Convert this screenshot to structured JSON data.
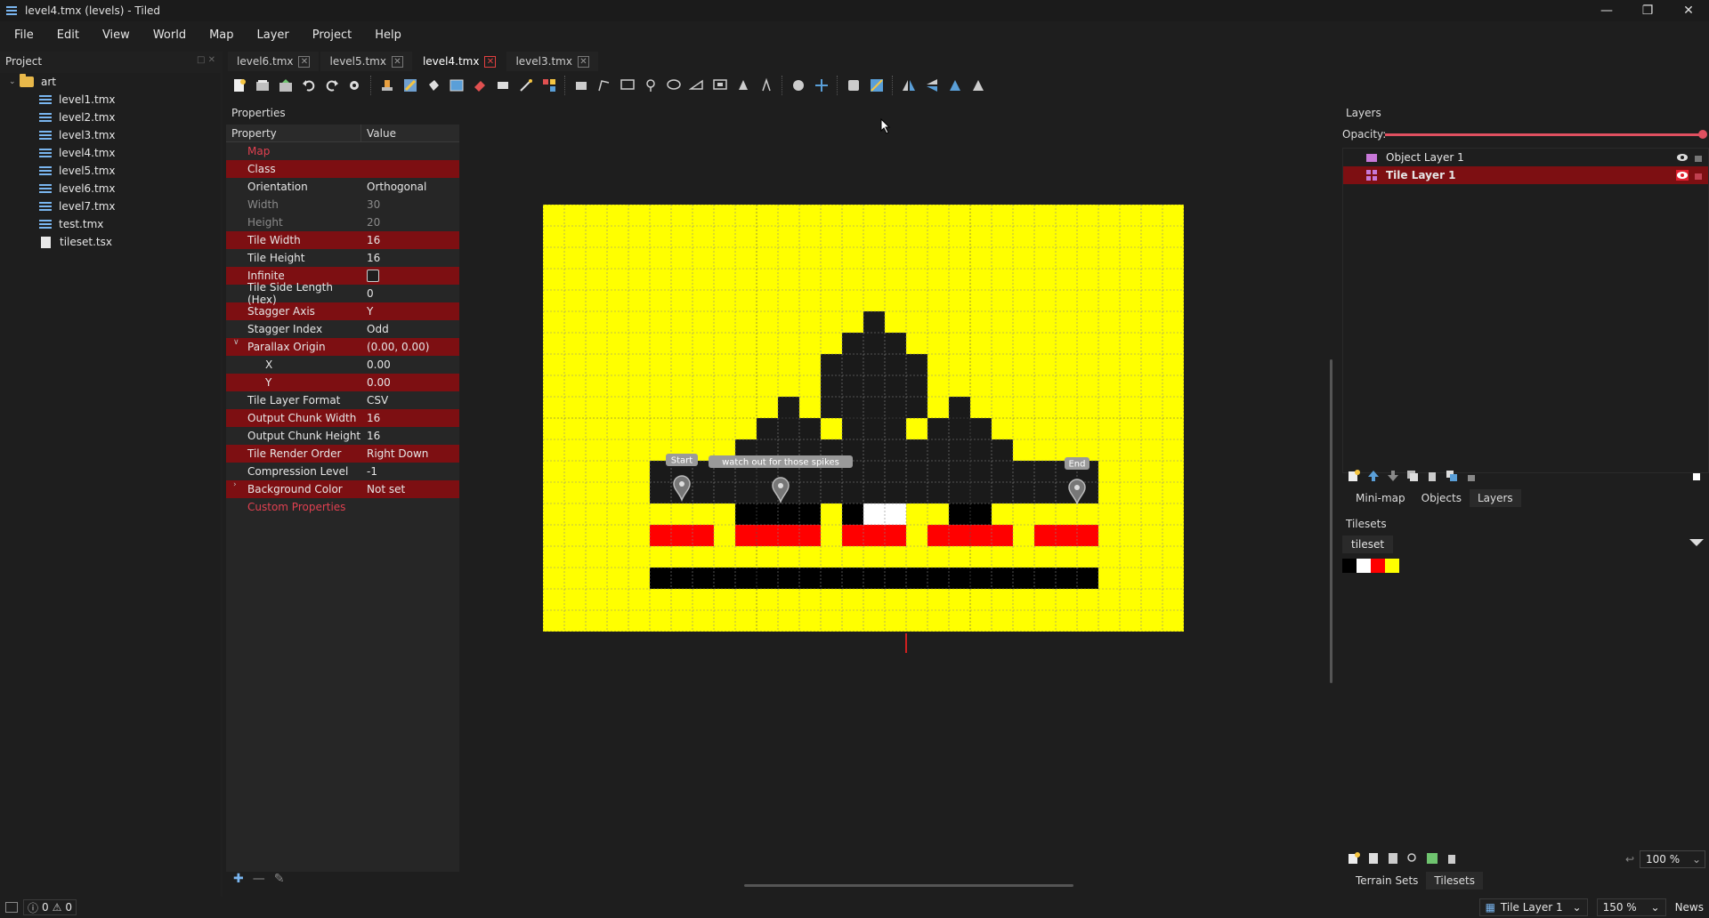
{
  "window": {
    "title": "level4.tmx (levels) - Tiled"
  },
  "menu": [
    "File",
    "Edit",
    "View",
    "World",
    "Map",
    "Layer",
    "Project",
    "Help"
  ],
  "project": {
    "title": "Project",
    "folder": "art",
    "files": [
      {
        "name": "level1.tmx",
        "type": "tmx"
      },
      {
        "name": "level2.tmx",
        "type": "tmx"
      },
      {
        "name": "level3.tmx",
        "type": "tmx"
      },
      {
        "name": "level4.tmx",
        "type": "tmx"
      },
      {
        "name": "level5.tmx",
        "type": "tmx"
      },
      {
        "name": "level6.tmx",
        "type": "tmx"
      },
      {
        "name": "level7.tmx",
        "type": "tmx"
      },
      {
        "name": "test.tmx",
        "type": "tmx"
      },
      {
        "name": "tileset.tsx",
        "type": "tsx"
      }
    ]
  },
  "tabs": [
    {
      "label": "level6.tmx",
      "active": false
    },
    {
      "label": "level5.tmx",
      "active": false
    },
    {
      "label": "level4.tmx",
      "active": true
    },
    {
      "label": "level3.tmx",
      "active": false
    }
  ],
  "properties": {
    "title": "Properties",
    "header": {
      "property": "Property",
      "value": "Value"
    },
    "rows": [
      {
        "key": "Map",
        "value": "",
        "style": "group"
      },
      {
        "key": "Class",
        "value": "",
        "style": "red"
      },
      {
        "key": "Orientation",
        "value": "Orthogonal",
        "style": "dark"
      },
      {
        "key": "Width",
        "value": "30",
        "style": "dim"
      },
      {
        "key": "Height",
        "value": "20",
        "style": "dim"
      },
      {
        "key": "Tile Width",
        "value": "16",
        "style": "red"
      },
      {
        "key": "Tile Height",
        "value": "16",
        "style": "dark"
      },
      {
        "key": "Infinite",
        "value": "",
        "style": "red",
        "checkbox": true
      },
      {
        "key": "Tile Side Length (Hex)",
        "value": "0",
        "style": "dark"
      },
      {
        "key": "Stagger Axis",
        "value": "Y",
        "style": "red"
      },
      {
        "key": "Stagger Index",
        "value": "Odd",
        "style": "dark"
      },
      {
        "key": "Parallax Origin",
        "value": "(0.00, 0.00)",
        "style": "red",
        "expander": "v"
      },
      {
        "key": "X",
        "value": "0.00",
        "style": "dark",
        "sub": true
      },
      {
        "key": "Y",
        "value": "0.00",
        "style": "red",
        "sub": true
      },
      {
        "key": "Tile Layer Format",
        "value": "CSV",
        "style": "dark"
      },
      {
        "key": "Output Chunk Width",
        "value": "16",
        "style": "red"
      },
      {
        "key": "Output Chunk Height",
        "value": "16",
        "style": "dark"
      },
      {
        "key": "Tile Render Order",
        "value": "Right Down",
        "style": "red"
      },
      {
        "key": "Compression Level",
        "value": "-1",
        "style": "dark"
      },
      {
        "key": "Background Color",
        "value": "Not set",
        "style": "red",
        "expander": ">"
      },
      {
        "key": "Custom Properties",
        "value": "",
        "style": "group"
      }
    ]
  },
  "map": {
    "labels": {
      "start": "Start",
      "spikes": "watch out for those spikes",
      "end": "End"
    },
    "colors": {
      "yellow": "#ffff00",
      "black": "#000000",
      "red": "#ff0000",
      "white": "#ffffff",
      "dark": "#1a1a1a"
    }
  },
  "layers": {
    "title": "Layers",
    "opacity_label": "Opacity:",
    "opacity": 1.0,
    "items": [
      {
        "name": "Object Layer 1",
        "type": "object",
        "selected": false
      },
      {
        "name": "Tile Layer 1",
        "type": "tile",
        "selected": true
      }
    ],
    "tabs": [
      "Mini-map",
      "Objects",
      "Layers"
    ],
    "active_tab": "Layers"
  },
  "tilesets": {
    "title": "Tilesets",
    "tab": "tileset",
    "tiles": [
      "#000000",
      "#ffffff",
      "#ff0000",
      "#ffff00"
    ],
    "zoom": "100 %",
    "tabs": [
      "Terrain Sets",
      "Tilesets"
    ],
    "active_tab": "Tilesets"
  },
  "statusbar": {
    "errors": "0",
    "warnings": "0",
    "layer": "Tile Layer 1",
    "zoom": "150 %",
    "news": "News"
  }
}
